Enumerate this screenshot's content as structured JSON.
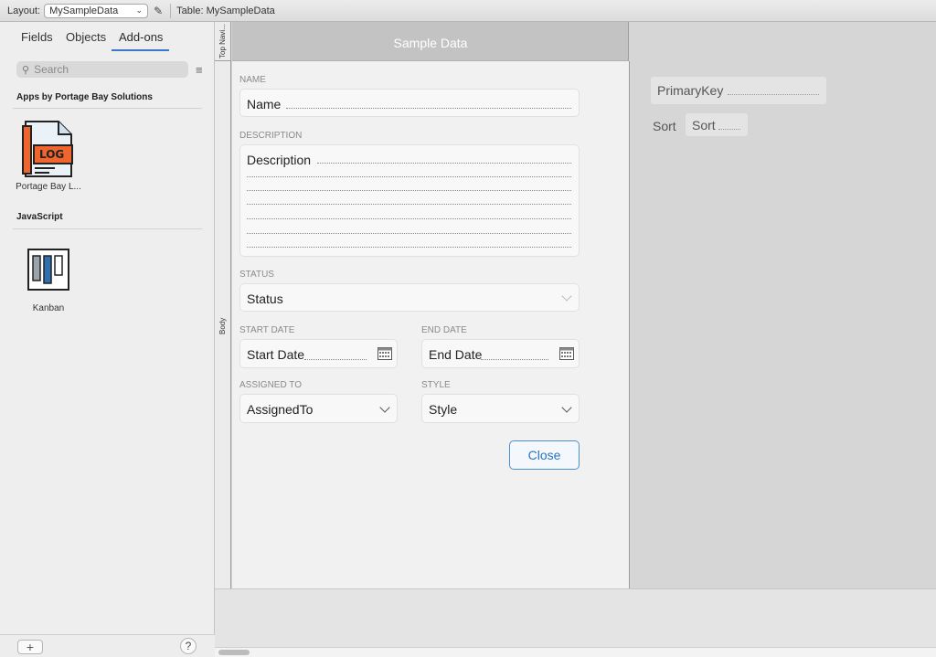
{
  "topbar": {
    "layout_label": "Layout:",
    "layout_value": "MySampleData",
    "table_label": "Table: MySampleData"
  },
  "left_panel": {
    "tabs": [
      {
        "label": "Fields"
      },
      {
        "label": "Objects"
      },
      {
        "label": "Add-ons",
        "active": true
      }
    ],
    "search_placeholder": "Search",
    "sections": [
      {
        "title": "Apps by Portage Bay Solutions",
        "items": [
          {
            "label": "Portage Bay L...",
            "icon": "log-file-icon"
          }
        ]
      },
      {
        "title": "JavaScript",
        "items": [
          {
            "label": "Kanban",
            "icon": "kanban-icon"
          }
        ]
      }
    ],
    "log_icon_text": "LOG",
    "plus_label": "+",
    "help_label": "?"
  },
  "parts": {
    "top_nav": "Top Navi...",
    "body": "Body"
  },
  "layout": {
    "header_title": "Sample Data",
    "fields": {
      "name": {
        "label": "NAME",
        "value": "Name"
      },
      "description": {
        "label": "DESCRIPTION",
        "value": "Description"
      },
      "status": {
        "label": "STATUS",
        "value": "Status"
      },
      "start_date": {
        "label": "START DATE",
        "value": "Start Date"
      },
      "end_date": {
        "label": "END DATE",
        "value": "End Date"
      },
      "assigned_to": {
        "label": "ASSIGNED TO",
        "value": "AssignedTo"
      },
      "style": {
        "label": "STYLE",
        "value": "Style"
      }
    },
    "close_button": "Close"
  },
  "gutter": {
    "primary_key": "PrimaryKey",
    "sort_label": "Sort",
    "sort_field": "Sort"
  },
  "colors": {
    "accent": "#3c78c8",
    "header_band": "#c3c3c3",
    "log_orange": "#f0642d"
  }
}
